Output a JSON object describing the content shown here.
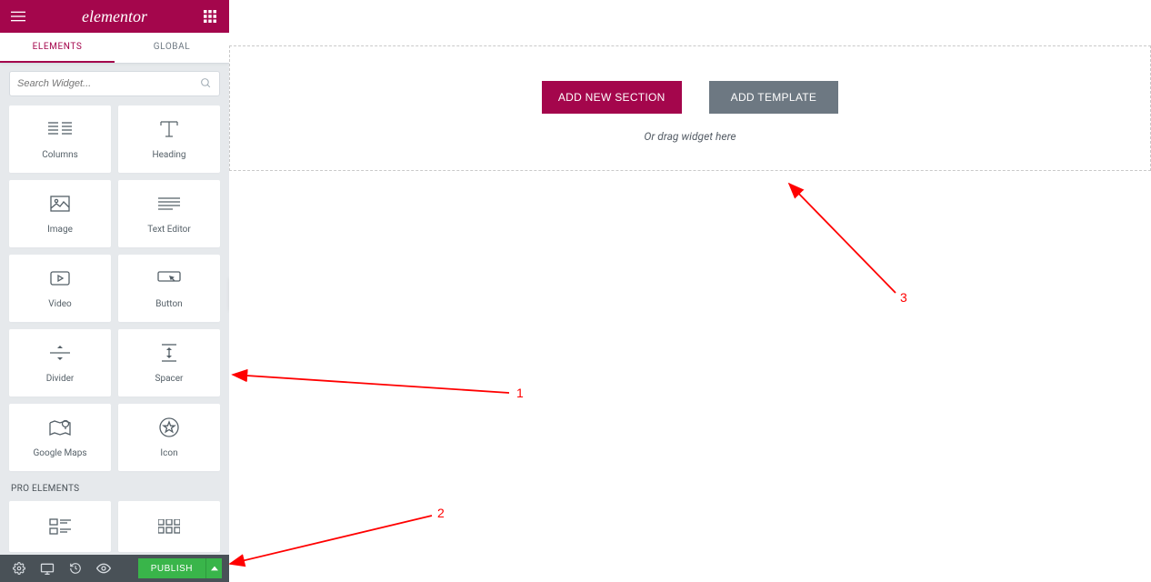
{
  "brand": "elementor",
  "tabs": {
    "elements": "ELEMENTS",
    "global": "GLOBAL"
  },
  "search": {
    "placeholder": "Search Widget..."
  },
  "widgets": [
    {
      "label": "Columns",
      "icon": "columns"
    },
    {
      "label": "Heading",
      "icon": "heading"
    },
    {
      "label": "Image",
      "icon": "image"
    },
    {
      "label": "Text Editor",
      "icon": "text"
    },
    {
      "label": "Video",
      "icon": "video"
    },
    {
      "label": "Button",
      "icon": "button"
    },
    {
      "label": "Divider",
      "icon": "divider"
    },
    {
      "label": "Spacer",
      "icon": "spacer"
    },
    {
      "label": "Google Maps",
      "icon": "map"
    },
    {
      "label": "Icon",
      "icon": "icon"
    }
  ],
  "section_pro": "PRO ELEMENTS",
  "pro_widgets": [
    {
      "label": "",
      "icon": "posts"
    },
    {
      "label": "",
      "icon": "portfolio"
    }
  ],
  "footer": {
    "publish": "PUBLISH"
  },
  "canvas": {
    "add_section": "ADD NEW SECTION",
    "add_template": "ADD TEMPLATE",
    "drag_hint": "Or drag widget here"
  },
  "annotations": {
    "a1": "1",
    "a2": "2",
    "a3": "3"
  },
  "colors": {
    "accent": "#a4064c",
    "publish": "#39b54a"
  }
}
